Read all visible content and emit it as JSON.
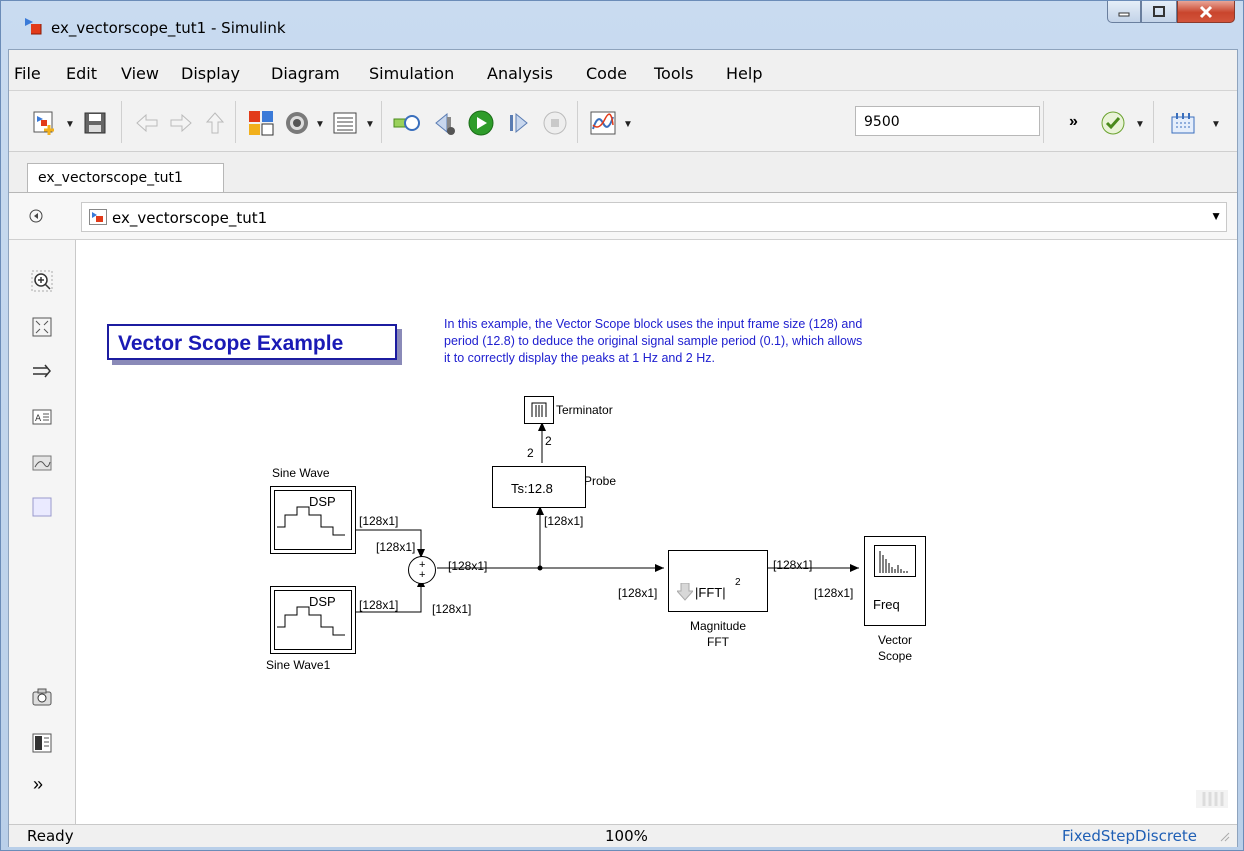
{
  "window": {
    "title": "ex_vectorscope_tut1 - Simulink"
  },
  "menu": [
    "File",
    "Edit",
    "View",
    "Display",
    "Diagram",
    "Simulation",
    "Analysis",
    "Code",
    "Tools",
    "Help"
  ],
  "toolbar": {
    "stop_time": "9500",
    "more": "»"
  },
  "tab": {
    "label": "ex_vectorscope_tut1"
  },
  "breadcrumb": {
    "model": "ex_vectorscope_tut1"
  },
  "palette": {
    "more": "»"
  },
  "diagram": {
    "title": "Vector Scope Example",
    "description_lines": [
      "In this example, the Vector Scope block uses the input frame size (128) and",
      "period (12.8) to deduce the original signal sample period (0.1), which allows",
      "it to correctly display the peaks at 1 Hz and 2 Hz."
    ],
    "terminator_label": "Terminator",
    "probe_text": "Ts:12.8",
    "probe_label": "Probe",
    "sine1_label": "Sine Wave",
    "sine2_label": "Sine Wave1",
    "dsp": "DSP",
    "fft_text": "|FFT|",
    "fft_exp": "2",
    "fft_label": [
      "Magnitude",
      "FFT"
    ],
    "scope_text": "Freq",
    "scope_label": [
      "Vector",
      "Scope"
    ],
    "signal": "[128x1]",
    "sum_signs": [
      "+",
      "+"
    ],
    "dim2": "2"
  },
  "status": {
    "left": "Ready",
    "zoom": "100%",
    "solver": "FixedStepDiscrete"
  }
}
